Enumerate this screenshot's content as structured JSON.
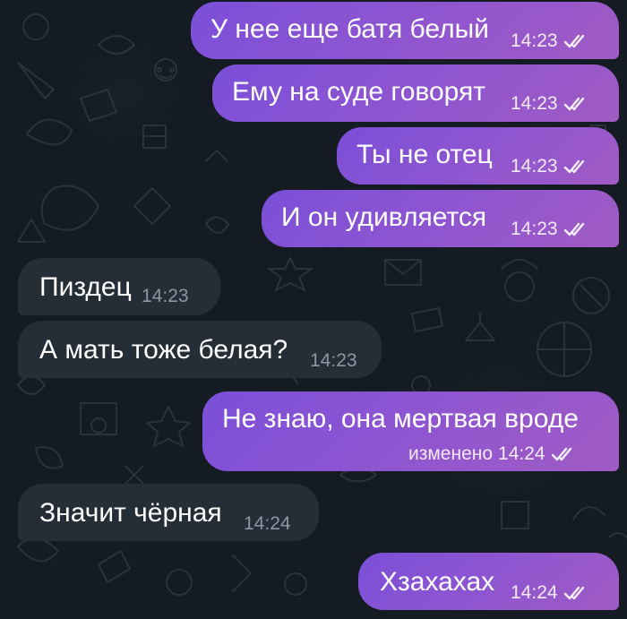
{
  "messages": [
    {
      "text": "У нее еще батя белый",
      "time": "14:23",
      "direction": "outgoing",
      "status": "read-double-check-icon"
    },
    {
      "text": "Ему на суде говорят",
      "time": "14:23",
      "direction": "outgoing",
      "status": "read-double-check-icon"
    },
    {
      "text": "Ты не отец",
      "time": "14:23",
      "direction": "outgoing",
      "status": "read-double-check-icon"
    },
    {
      "text": "И он удивляется",
      "time": "14:23",
      "direction": "outgoing",
      "status": "read-double-check-icon"
    },
    {
      "text": "Пиздец",
      "time": "14:23",
      "direction": "incoming"
    },
    {
      "text": "А мать тоже белая?",
      "time": "14:23",
      "direction": "incoming"
    },
    {
      "text": "Не знаю, она мертвая вроде",
      "edited": "изменено",
      "time": "14:24",
      "direction": "outgoing",
      "status": "read-double-check-icon"
    },
    {
      "text": "Значит чёрная",
      "time": "14:24",
      "direction": "incoming"
    },
    {
      "text": "Хзахахах",
      "time": "14:24",
      "direction": "outgoing",
      "status": "read-double-check-icon"
    }
  ],
  "colors": {
    "background": "#141b22",
    "outgoing_bubble": "#8f55d0",
    "incoming_bubble": "#252d37"
  }
}
